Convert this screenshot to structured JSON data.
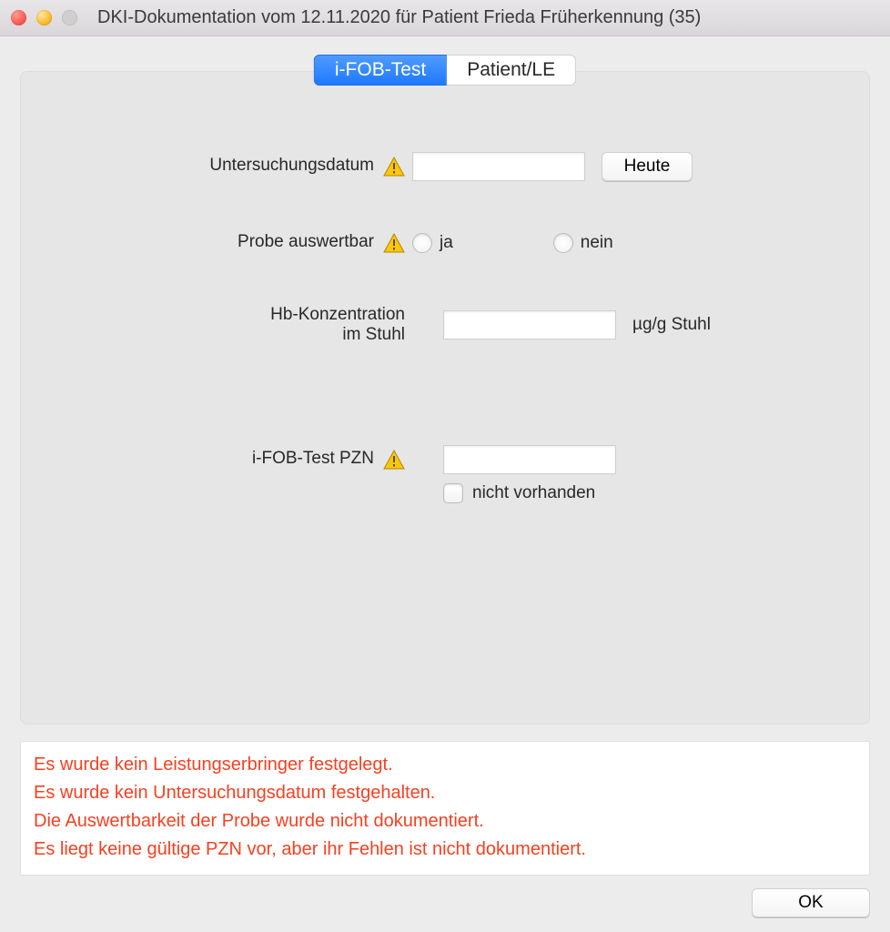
{
  "window": {
    "title": "DKI-Dokumentation vom 12.11.2020 für Patient Frieda Früherkennung (35)"
  },
  "tabs": [
    {
      "label": "i-FOB-Test",
      "selected": true
    },
    {
      "label": "Patient/LE",
      "selected": false
    }
  ],
  "form": {
    "exam_date": {
      "label": "Untersuchungsdatum",
      "value": "",
      "warn": true,
      "today_button": "Heute"
    },
    "evaluable": {
      "label": "Probe auswertbar",
      "warn": true,
      "value": null,
      "options": {
        "yes": "ja",
        "no": "nein"
      }
    },
    "hb": {
      "label_line1": "Hb-Konzentration",
      "label_line2": "im Stuhl",
      "value": "",
      "warn": false,
      "unit": "µg/g Stuhl"
    },
    "pzn": {
      "label": "i-FOB-Test PZN",
      "value": "",
      "warn": true,
      "not_available": {
        "checked": false,
        "label": "nicht vorhanden"
      }
    }
  },
  "errors": [
    "Es wurde kein Leistungserbringer festgelegt.",
    "Es wurde kein Untersuchungsdatum festgehalten.",
    "Die Auswertbarkeit der Probe wurde nicht dokumentiert.",
    "Es liegt keine gültige PZN vor, aber ihr Fehlen ist nicht dokumentiert."
  ],
  "footer": {
    "ok": "OK"
  }
}
